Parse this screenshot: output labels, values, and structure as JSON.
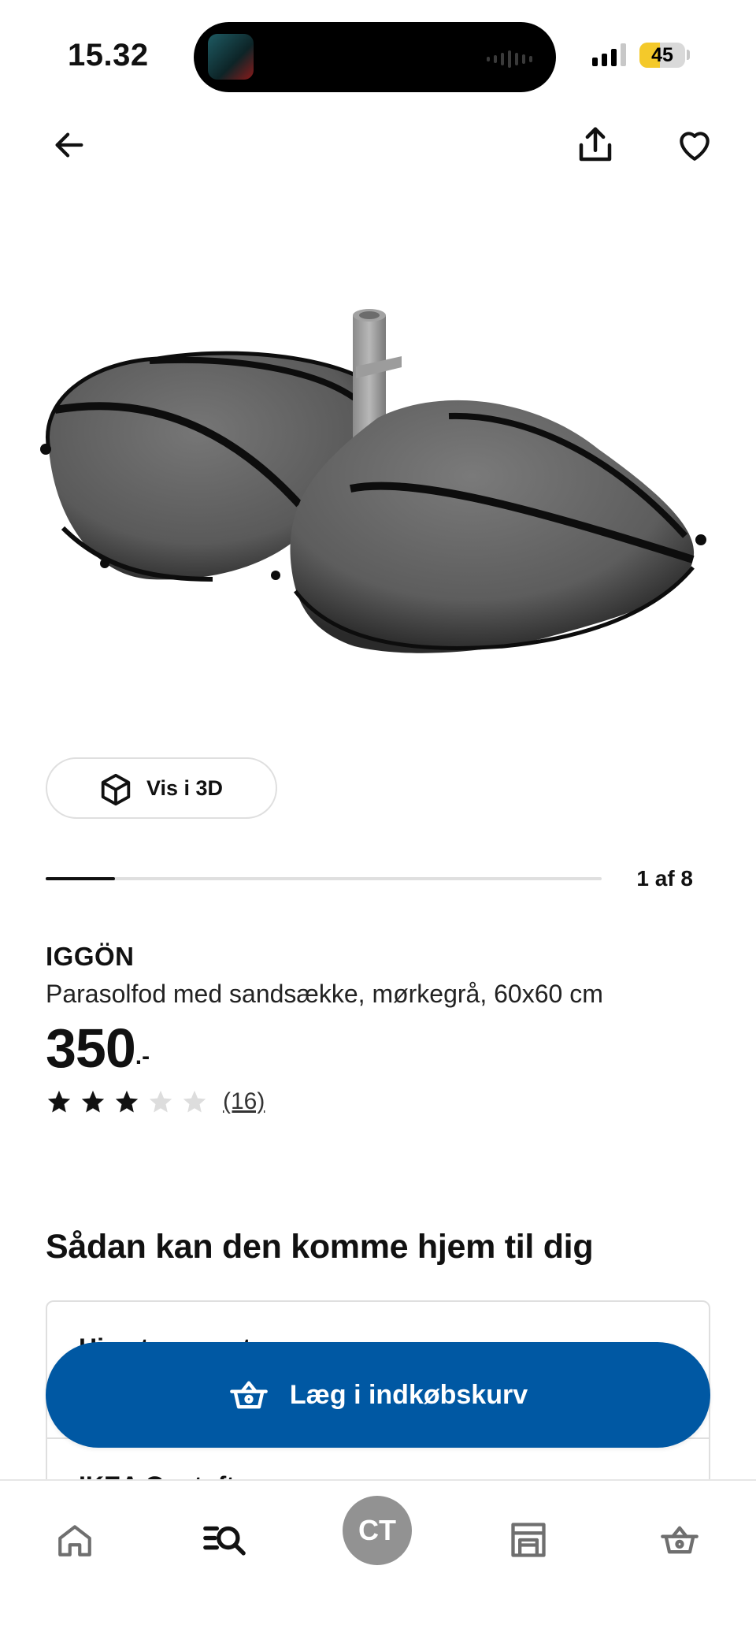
{
  "status_bar": {
    "time": "15.32",
    "battery": "45",
    "battery_level": 0.45,
    "signal_bars": 3
  },
  "top_nav": {
    "back_icon": "arrow-left-icon",
    "share_icon": "share-icon",
    "favourite_icon": "heart-icon"
  },
  "media": {
    "view_3d_label": "Vis i 3D",
    "image_index_label": "1 af 8",
    "current_image": 1,
    "total_images": 8
  },
  "product": {
    "brand": "IGGÖN",
    "description": "Parasolfod med sandsække, mørkegrå, 60x60 cm",
    "price_integer": "350",
    "price_suffix": ".-",
    "rating_stars": 3,
    "rating_max": 5,
    "review_count": "(16)"
  },
  "delivery": {
    "section_title": "Sådan kan den komme hjem til dig",
    "option_1": "Hjemtransport",
    "option_2": "IKEA Gentofte"
  },
  "cart": {
    "add_to_cart_label": "Læg i indkøbskurv",
    "button_color": "#0058a3"
  },
  "tabbar": {
    "home_icon": "home-icon",
    "search_icon": "search-icon",
    "avatar_initials": "CT",
    "store_icon": "store-icon",
    "basket_icon": "basket-icon"
  },
  "colors": {
    "star_filled": "#111111",
    "star_empty": "#dddddd"
  }
}
